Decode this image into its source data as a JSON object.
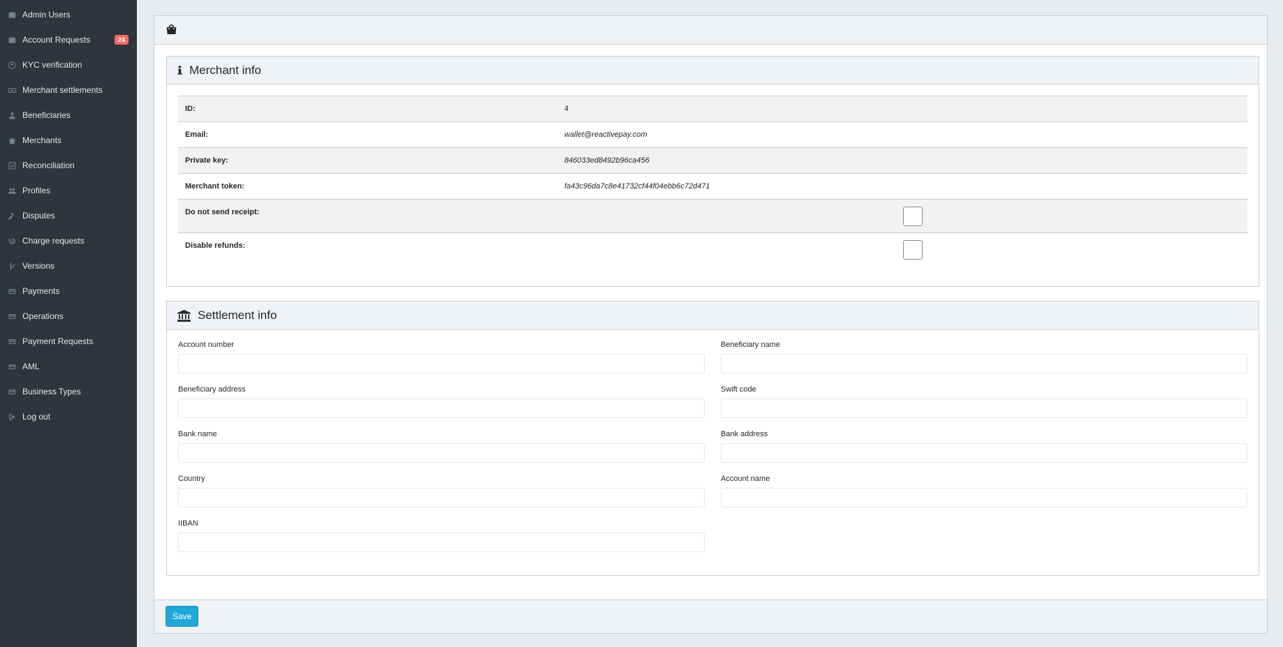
{
  "sidebar": {
    "items": [
      {
        "label": "Admin Users",
        "icon": "briefcase-icon"
      },
      {
        "label": "Account Requests",
        "icon": "briefcase-icon",
        "badge": "24"
      },
      {
        "label": "KYC verification",
        "icon": "user-circle-icon"
      },
      {
        "label": "Merchant settlements",
        "icon": "money-icon"
      },
      {
        "label": "Beneficiaries",
        "icon": "user-icon"
      },
      {
        "label": "Merchants",
        "icon": "shopping-bag-icon"
      },
      {
        "label": "Reconciliation",
        "icon": "check-square-icon"
      },
      {
        "label": "Profiles",
        "icon": "users-icon"
      },
      {
        "label": "Disputes",
        "icon": "gavel-icon"
      },
      {
        "label": "Charge requests",
        "icon": "history-icon"
      },
      {
        "label": "Versions",
        "icon": "code-branch-icon"
      },
      {
        "label": "Payments",
        "icon": "credit-card-icon"
      },
      {
        "label": "Operations",
        "icon": "credit-card-icon"
      },
      {
        "label": "Payment Requests",
        "icon": "credit-card-icon"
      },
      {
        "label": "AML",
        "icon": "credit-card-icon"
      },
      {
        "label": "Business Types",
        "icon": "credit-card-icon"
      },
      {
        "label": "Log out",
        "icon": "sign-out-icon"
      }
    ],
    "colors": {
      "background": "#2f353b",
      "badge": "#f86c6b"
    }
  },
  "card": {
    "header_icon": "shopping-bag-icon"
  },
  "merchant_info": {
    "title": "Merchant info",
    "icon": "info-icon",
    "id_label": "ID:",
    "id_value": "4",
    "email_label": "Email:",
    "email_value": "wallet@reactivepay.com",
    "private_key_label": "Private key:",
    "private_key_value": "846033ed8492b96ca456",
    "merchant_token_label": "Merchant token:",
    "merchant_token_value": "fa43c96da7c8e41732cf44f04ebb6c72d471",
    "no_receipt_label": "Do not send receipt:",
    "disable_refunds_label": "Disable refunds:"
  },
  "settlement_info": {
    "title": "Settlement info",
    "icon": "bank-icon",
    "fields": {
      "account_number": {
        "label": "Account number",
        "value": ""
      },
      "beneficiary_name": {
        "label": "Beneficiary name",
        "value": ""
      },
      "beneficiary_address": {
        "label": "Beneficiary address",
        "value": ""
      },
      "swift_code": {
        "label": "Swift code",
        "value": ""
      },
      "bank_name": {
        "label": "Bank name",
        "value": ""
      },
      "bank_address": {
        "label": "Bank address",
        "value": ""
      },
      "country": {
        "label": "Country",
        "value": ""
      },
      "account_name": {
        "label": "Account name",
        "value": ""
      },
      "iiban": {
        "label": "IIBAN",
        "value": ""
      }
    }
  },
  "footer": {
    "save_label": "Save",
    "accent": "#20a8d8"
  }
}
